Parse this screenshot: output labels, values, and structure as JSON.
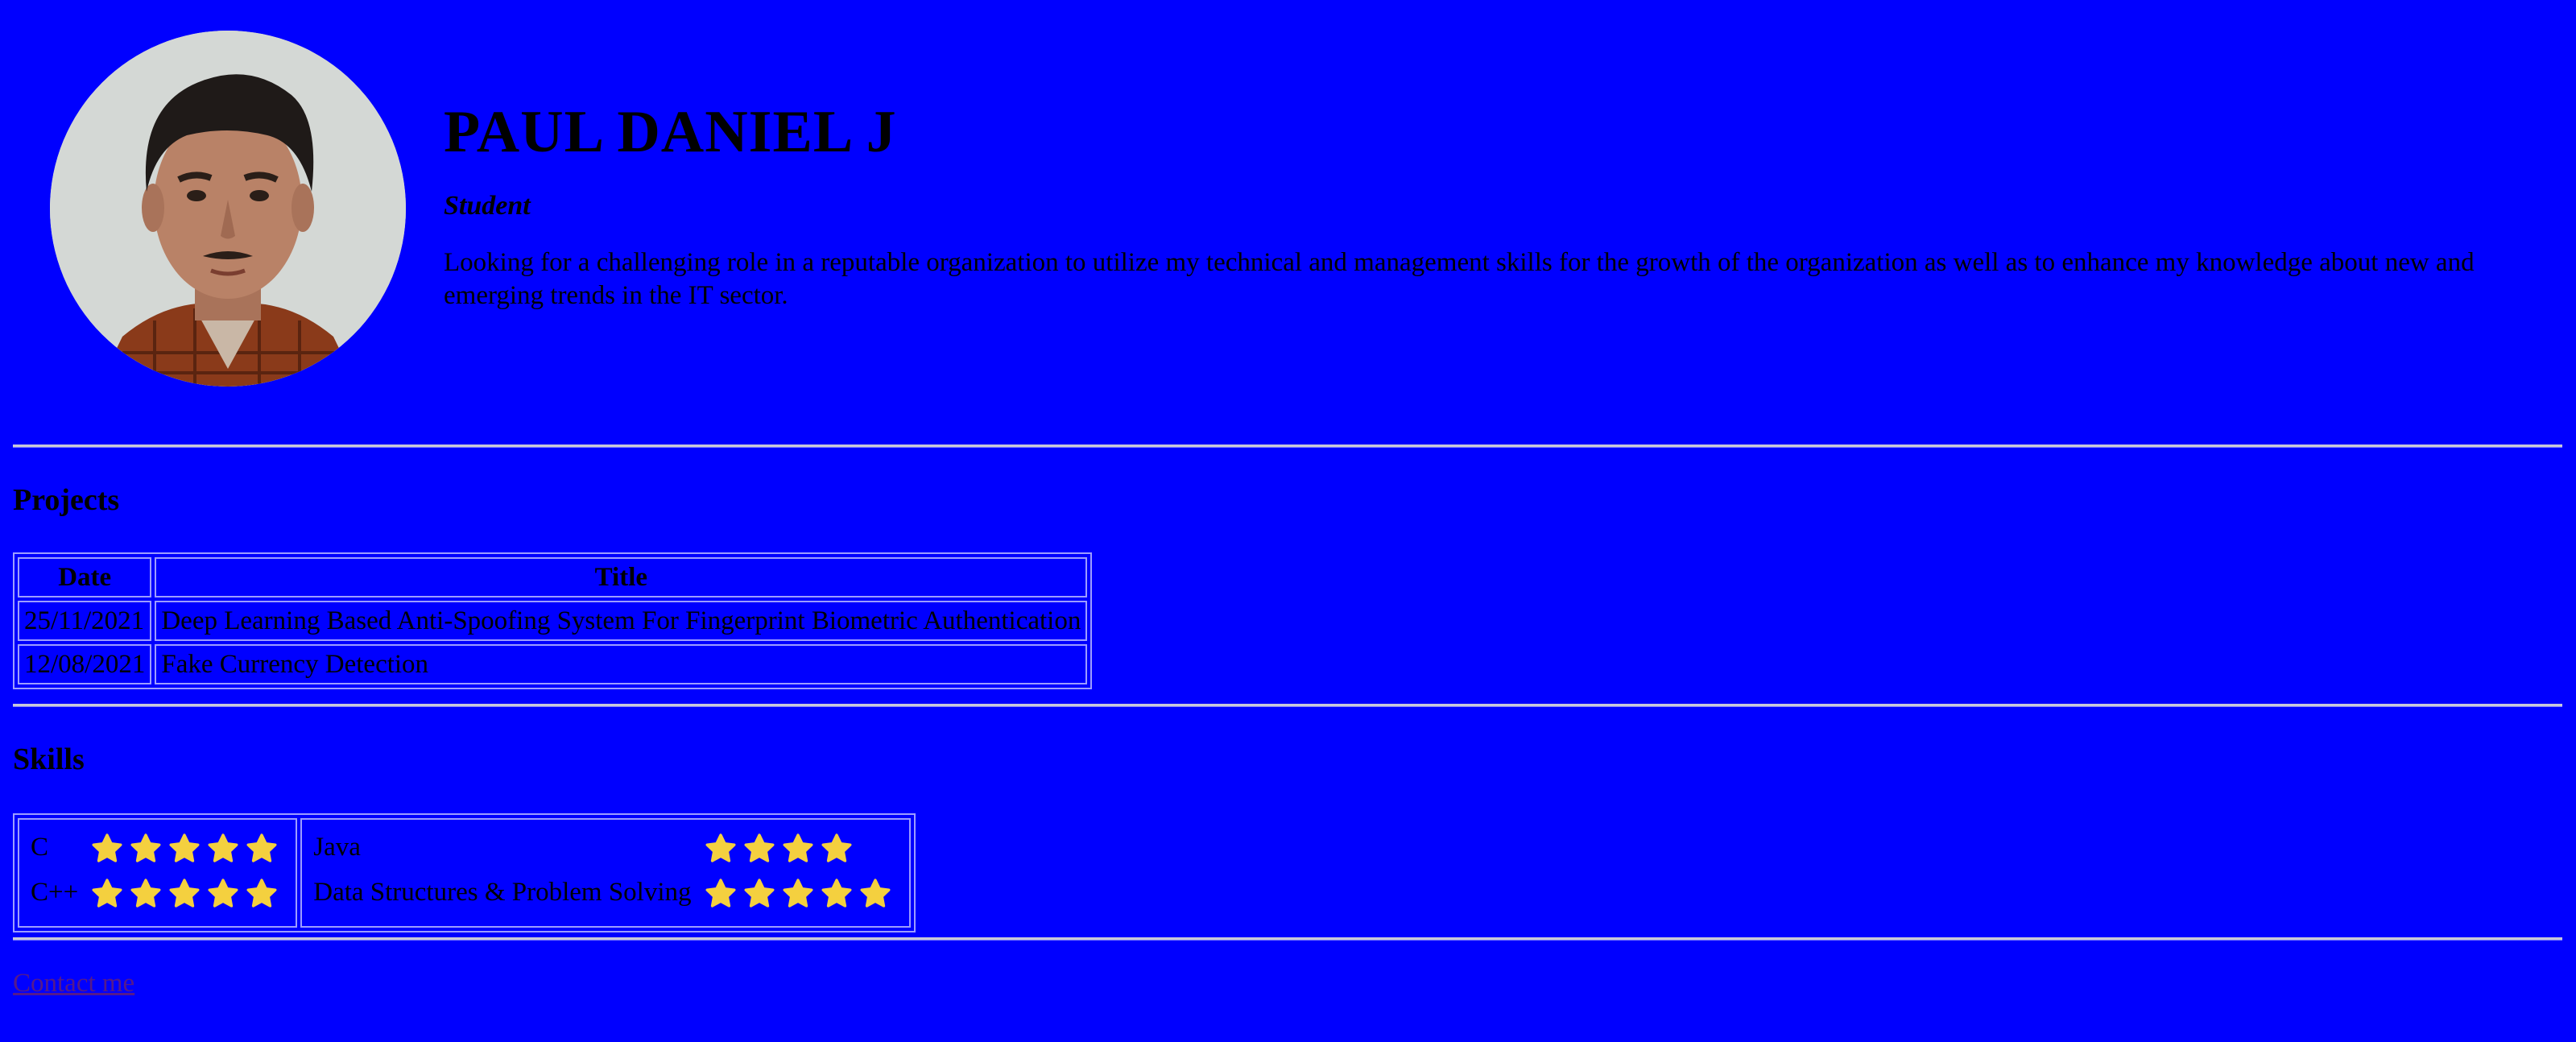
{
  "profile": {
    "name": "PAUL DANIEL J",
    "role": "Student",
    "summary": "Looking for a challenging role in a reputable organization to utilize my technical and management skills for the growth of the organization as well as to enhance my knowledge about new and emerging trends in the IT sector."
  },
  "projects": {
    "title": "Projects",
    "headers": [
      "Date",
      "Title"
    ],
    "rows": [
      {
        "date": "25/11/2021",
        "title": "Deep Learning Based Anti-Spoofing System For Fingerprint Biometric Authentication"
      },
      {
        "date": "12/08/2021",
        "title": "Fake Currency Detection"
      }
    ]
  },
  "skills": {
    "title": "Skills",
    "star_color": "#f4d03f",
    "left": [
      {
        "name": "C",
        "rating": 5
      },
      {
        "name": "C++",
        "rating": 5
      }
    ],
    "right": [
      {
        "name": "Java",
        "rating": 4
      },
      {
        "name": "Data Structures & Problem Solving",
        "rating": 5
      }
    ]
  },
  "contact": {
    "label": "Contact me"
  },
  "colors": {
    "background": "#0000ff",
    "text": "#000000",
    "link": "#551a8b"
  }
}
